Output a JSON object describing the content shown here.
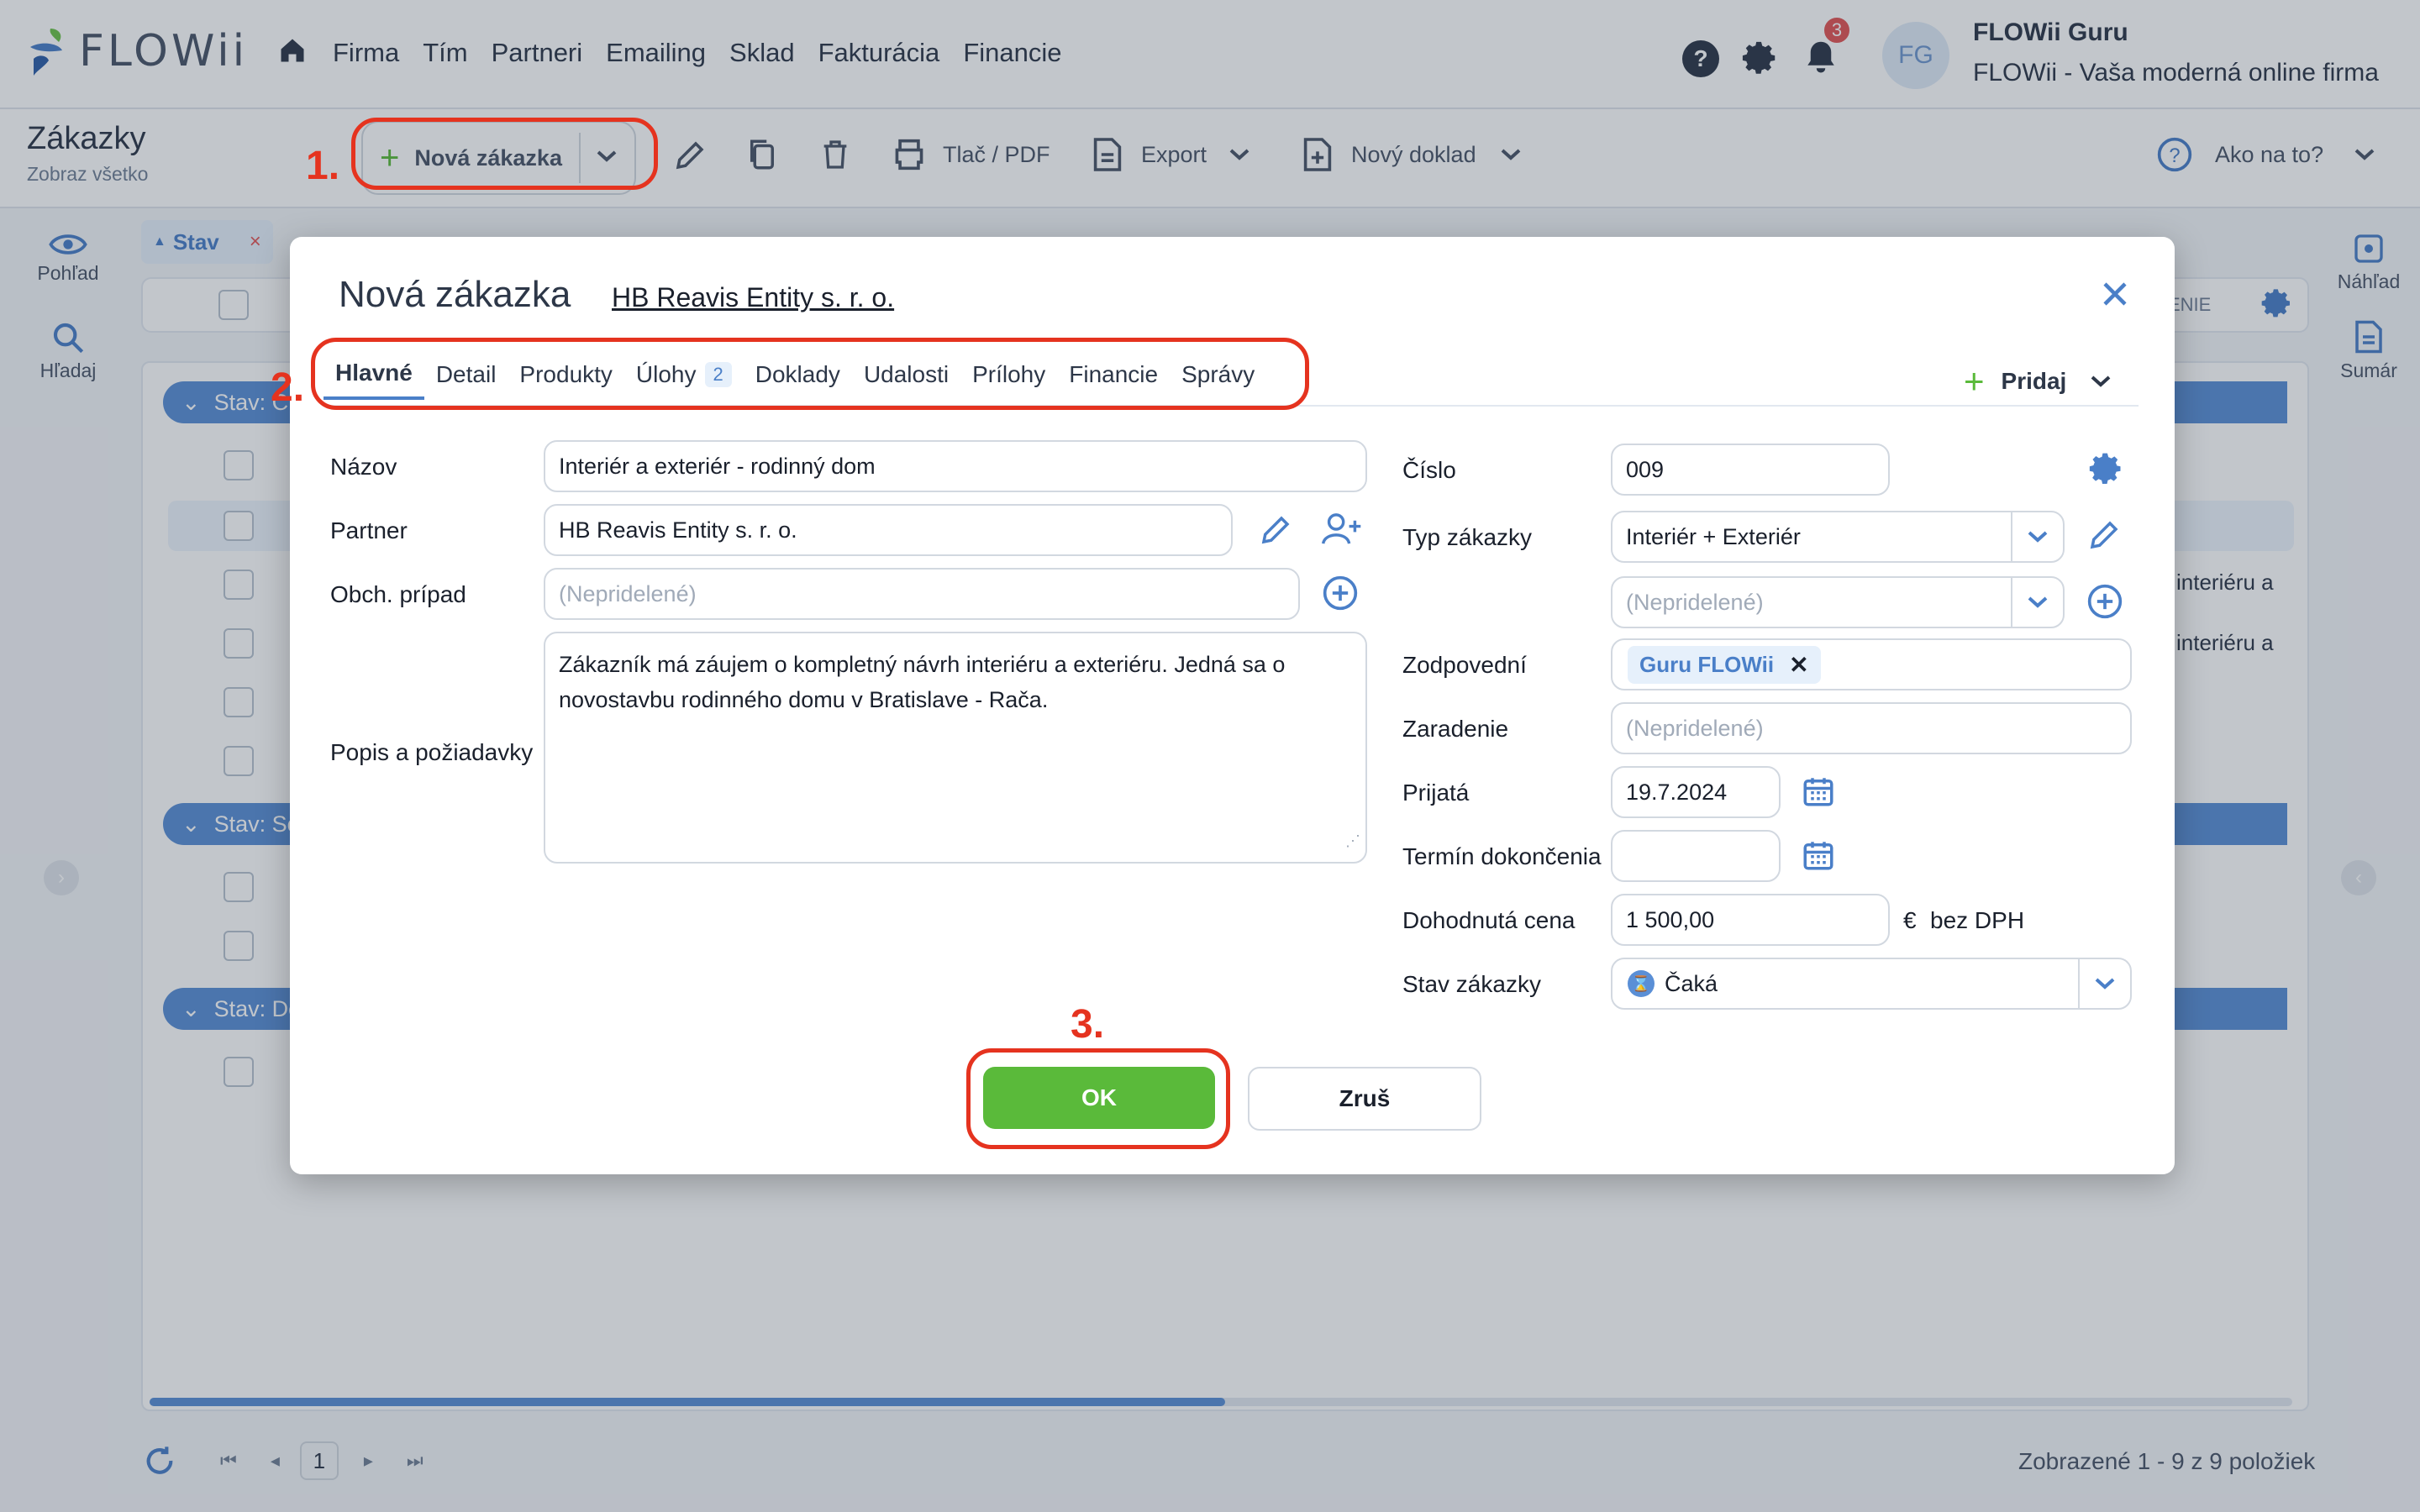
{
  "app": {
    "logo": "FLOWii",
    "nav": [
      "Firma",
      "Tím",
      "Partneri",
      "Emailing",
      "Sklad",
      "Fakturácia",
      "Financie"
    ],
    "notifications_count": "3",
    "avatar_initials": "FG",
    "user_name": "FLOWii Guru",
    "user_company": "FLOWii - Vaša moderná online firma"
  },
  "page": {
    "title": "Zákazky",
    "subtitle": "Zobraz všetko"
  },
  "toolbar": {
    "new_label": "Nová zákazka",
    "print_label": "Tlač / PDF",
    "export_label": "Export",
    "new_doc_label": "Nový doklad",
    "help_label": "Ako na to?"
  },
  "left_rail": {
    "view_label": "Pohľad",
    "search_label": "Hľadaj"
  },
  "right_rail": {
    "preview_label": "Náhľad",
    "summary_label": "Sumár"
  },
  "filter": {
    "label": "Stav",
    "remove": "×"
  },
  "list": {
    "column_tail": "ENIE",
    "groups": [
      "Stav: C",
      "Stav: So",
      "Stav: Do"
    ],
    "row_snippets": [
      "interiéru a",
      "interiéru a"
    ],
    "page_number": "1",
    "summary": "Zobrazené 1 - 9 z 9 položiek"
  },
  "modal": {
    "title": "Nová zákazka",
    "partner_link": "HB Reavis Entity s. r. o.",
    "tabs": [
      {
        "label": "Hlavné"
      },
      {
        "label": "Detail"
      },
      {
        "label": "Produkty"
      },
      {
        "label": "Úlohy",
        "count": "2"
      },
      {
        "label": "Doklady"
      },
      {
        "label": "Udalosti"
      },
      {
        "label": "Prílohy"
      },
      {
        "label": "Financie"
      },
      {
        "label": "Správy"
      }
    ],
    "add_label": "Pridaj",
    "left": {
      "name_label": "Názov",
      "name_value": "Interiér a exteriér - rodinný dom",
      "partner_label": "Partner",
      "partner_value": "HB Reavis Entity s. r. o.",
      "case_label": "Obch. prípad",
      "case_placeholder": "(Nepridelené)",
      "desc_label": "Popis a požiadavky",
      "desc_value": "Zákazník má záujem o kompletný návrh interiéru a exteriéru. Jedná sa o novostavbu rodinného domu v Bratislave - Rača."
    },
    "right": {
      "number_label": "Číslo",
      "number_value": "009",
      "type_label": "Typ zákazky",
      "type_value": "Interiér + Exteriér",
      "subtype_placeholder": "(Nepridelené)",
      "responsible_label": "Zodpovední",
      "responsible_chip": "Guru FLOWii",
      "category_label": "Zaradenie",
      "category_placeholder": "(Nepridelené)",
      "received_label": "Prijatá",
      "received_value": "19.7.2024",
      "deadline_label": "Termín dokončenia",
      "deadline_value": "",
      "price_label": "Dohodnutá cena",
      "price_value": "1 500,00",
      "price_currency": "€",
      "price_suffix": "bez DPH",
      "status_label": "Stav zákazky",
      "status_value": "Čaká"
    },
    "ok_label": "OK",
    "cancel_label": "Zruš"
  },
  "annotations": [
    "1.",
    "2.",
    "3."
  ],
  "colors": {
    "accent": "#4a7fc8",
    "ok_green": "#5aba3a",
    "annotation_red": "#e5331f",
    "group_blue": "#5a8fd6"
  }
}
